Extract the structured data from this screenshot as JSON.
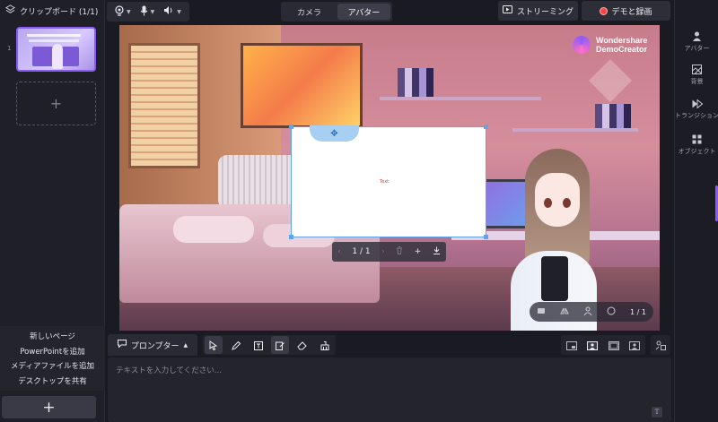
{
  "sidebar": {
    "title": "クリップボード (1/1)",
    "slide_number": "1",
    "thumbnail_caption": "あなたのアイデアで、世界を驚かそう！",
    "add_slide_symbol": "+",
    "add_menu": [
      "新しいページ",
      "PowerPointを追加",
      "メディアファイルを追加",
      "デスクトップを共有"
    ],
    "add_button_symbol": "+"
  },
  "toolbar": {
    "tabs": [
      {
        "label": "カメラ",
        "active": false
      },
      {
        "label": "アバター",
        "active": true
      }
    ],
    "streaming_label": "ストリーミング",
    "record_label": "デモと録画",
    "icons": [
      "camera-select-icon",
      "microphone-icon",
      "speaker-icon"
    ]
  },
  "right_rail": {
    "items": [
      {
        "label": "アバター",
        "icon": "avatar-icon"
      },
      {
        "label": "背景",
        "icon": "background-icon"
      },
      {
        "label": "トランジション",
        "icon": "transition-icon"
      },
      {
        "label": "オブジェクト",
        "icon": "object-icon"
      }
    ]
  },
  "canvas": {
    "watermark_line1": "Wondershare",
    "watermark_line2": "DemoCreator",
    "whiteboard_text": "Text",
    "page_indicator": "1 / 1",
    "avatar_page_indicator": "1 / 1"
  },
  "prompter": {
    "toggle_label": "プロンプター",
    "placeholder": "テキストを入力してください...",
    "text_style_glyph": "T"
  },
  "colors": {
    "accent": "#8a5cf6",
    "record": "#ff4545",
    "selection": "#63a4e8"
  }
}
